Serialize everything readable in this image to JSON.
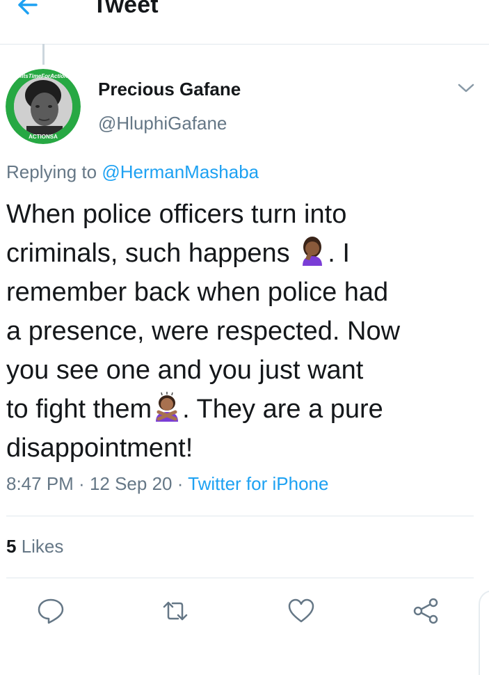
{
  "header": {
    "title": "Tweet"
  },
  "author": {
    "display_name": "Precious Gafane",
    "handle": "@HluphiGafane"
  },
  "replying": {
    "prefix": "Replying to ",
    "mention": "@HermanMashaba"
  },
  "tweet": {
    "lines": [
      "When police officers turn into",
      "criminals, such happens",
      ". I",
      "remember back when police had",
      "a presence, were respected. Now",
      "you see one and you just want",
      "to fight them",
      ". They are a pure",
      "disappointment!"
    ]
  },
  "meta": {
    "time": "8:47 PM",
    "sep1": " · ",
    "date": "12 Sep 20",
    "sep2": " · ",
    "source": "Twitter for iPhone"
  },
  "stats": {
    "likes_count": "5",
    "likes_label": " Likes"
  },
  "avatar_badge": {
    "top_text": "#ItsTimeForAction",
    "bottom_text": "ACTIONSA"
  },
  "colors": {
    "accent": "#1da1f2",
    "muted": "#657786",
    "text": "#14171a",
    "divider": "#e1e8ed",
    "badge_green": "#27a843"
  },
  "icons": [
    "back-arrow-icon",
    "chevron-down-icon",
    "reply-icon",
    "retweet-icon",
    "like-icon",
    "share-icon",
    "face-palm-emoji",
    "no-gesture-emoji"
  ]
}
